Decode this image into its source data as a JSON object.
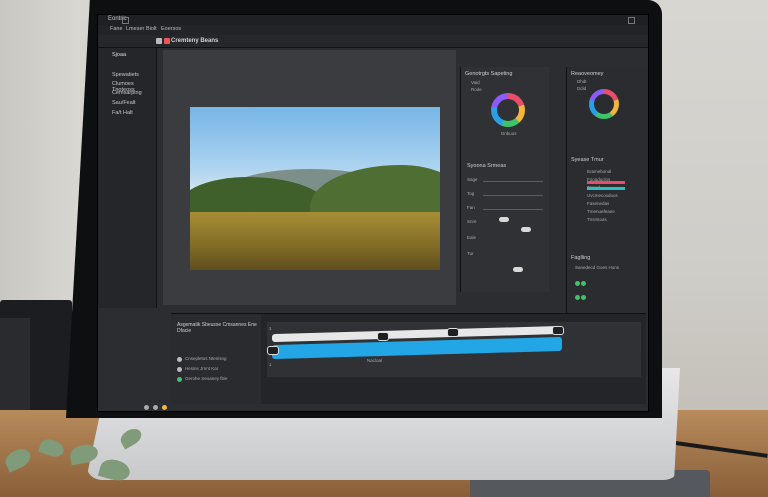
{
  "app": {
    "name": "Eontric",
    "document_title": "Cremteny Beans"
  },
  "menu": [
    "Fane",
    "Lmeser",
    "Biolt",
    "Eoersos"
  ],
  "left_panel": {
    "tab": "Sjoaa",
    "items": [
      "Spewatiets",
      "Clumoes Tnoteoss",
      "Cemsarping",
      "Sau/Fealt",
      "Fa/t Halt"
    ]
  },
  "right_panel_top": {
    "title": "Genotrgts Sapeting",
    "options": [
      "Vaid",
      "Rode"
    ],
    "ring_label": "Dnbuus"
  },
  "right_panel_mid": {
    "title": "Syoona Srmeas",
    "rows": [
      "Sage",
      "Tog",
      "Fan",
      "Snre",
      "Eale",
      "Tur"
    ]
  },
  "far_right_top": {
    "title": "Reaoveomey",
    "options": [
      "Dhdt",
      "Ddid"
    ]
  },
  "far_right_mid": {
    "title": "Syease Tmur",
    "rows": [
      "Eramebonal",
      "Fooaduclos",
      "Trrsed",
      "Uvcmecoxdoos",
      "Fasenedas",
      "Tmenuefeaee",
      "Tnsrstoas"
    ]
  },
  "far_right_bottom": {
    "title": "Faglling",
    "subtitle": "Sanedecd Goes Hons"
  },
  "bottom_panel": {
    "title": "Asgematik Sbeusse Cmsannes Ene Dfacie",
    "items": [
      "Cnsepletos Ntenisng",
      "Hesins Jrnnt Kar",
      "Gerohe Seoaney fbie"
    ],
    "timeline_label": "Nacloal",
    "scale_start": "1",
    "scale_end": "1"
  },
  "colors": {
    "accent_blue": "#22a6e5",
    "ring_colors": [
      "#e84e6a",
      "#f3b53a",
      "#3ec36a",
      "#2b9fe6",
      "#8b5cf6"
    ]
  }
}
